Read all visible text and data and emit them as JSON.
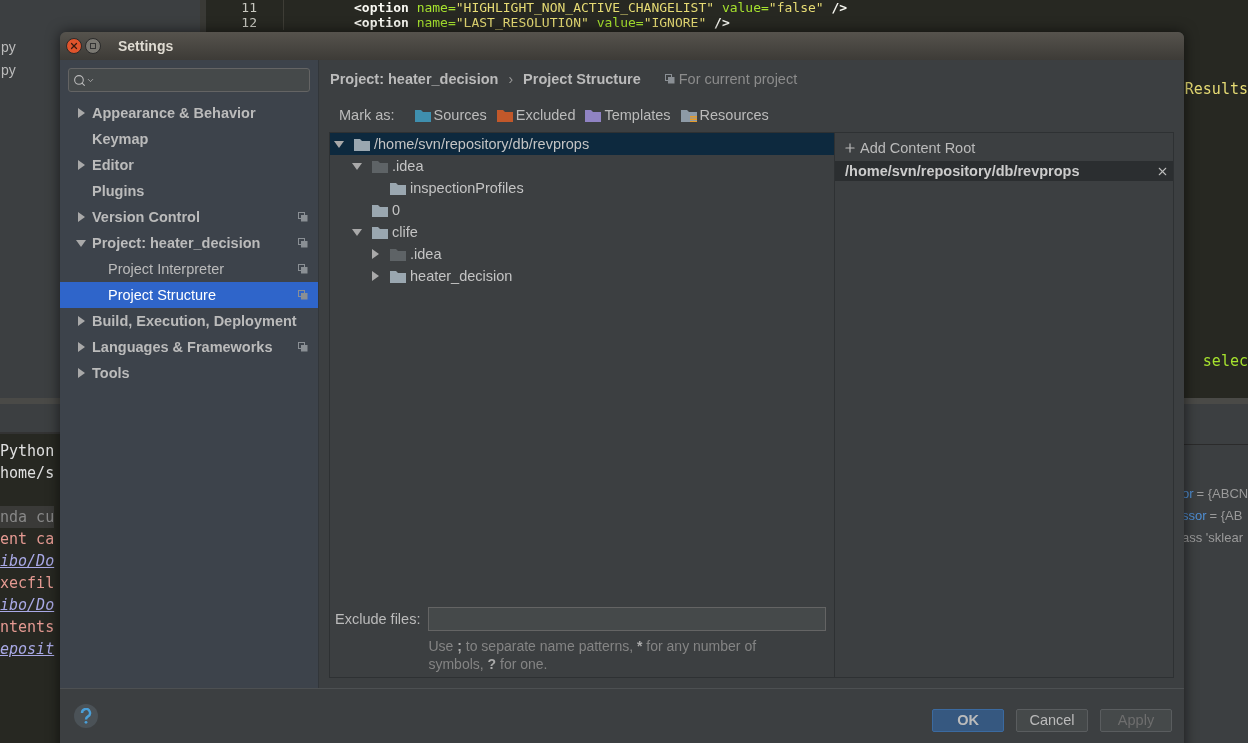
{
  "background": {
    "project_pane": {
      "items": [
        "py",
        "py"
      ]
    },
    "editor": {
      "lines": [
        {
          "number": "11",
          "segments": [
            {
              "kind": "tag",
              "text": "<option "
            },
            {
              "kind": "attr",
              "text": "name="
            },
            {
              "kind": "value",
              "text": "\"HIGHLIGHT_NON_ACTIVE_CHANGELIST\" "
            },
            {
              "kind": "attr",
              "text": "value="
            },
            {
              "kind": "value",
              "text": "\"false\" "
            },
            {
              "kind": "tag",
              "text": "/>"
            }
          ]
        },
        {
          "number": "12",
          "segments": [
            {
              "kind": "tag",
              "text": "<option "
            },
            {
              "kind": "attr",
              "text": "name="
            },
            {
              "kind": "value",
              "text": "\"LAST_RESOLUTION\" "
            },
            {
              "kind": "attr",
              "text": "value="
            },
            {
              "kind": "value",
              "text": "\"IGNORE\" "
            },
            {
              "kind": "tag",
              "text": "/>"
            }
          ]
        }
      ],
      "fragments": [
        "Results",
        "selec"
      ]
    },
    "console": {
      "lines": [
        {
          "kind": "plain",
          "text": "Python"
        },
        {
          "kind": "plain",
          "text": "home/s"
        },
        {
          "kind": "spacer"
        },
        {
          "kind": "comment",
          "text": "nda cu"
        },
        {
          "kind": "error",
          "text": "ent ca"
        },
        {
          "kind": "link",
          "text": "ibo/Do"
        },
        {
          "kind": "error",
          "text": "xecfil"
        },
        {
          "kind": "link",
          "text": "ibo/Do"
        },
        {
          "kind": "error",
          "text": "ntents"
        },
        {
          "kind": "link",
          "text": "eposit"
        }
      ]
    },
    "variables": {
      "rows": [
        {
          "name": "or",
          "value": "= {ABCN"
        },
        {
          "name": "ssor",
          "value": "= {AB"
        },
        {
          "name": "",
          "value": "ass 'sklear"
        }
      ]
    }
  },
  "window": {
    "title": "Settings"
  },
  "sidebar": {
    "items": [
      {
        "label": "Appearance & Behavior",
        "expanded": false,
        "project_level": false,
        "selected": false
      },
      {
        "label": "Keymap",
        "project_level": false,
        "selected": false
      },
      {
        "label": "Editor",
        "expanded": false,
        "project_level": false,
        "selected": false
      },
      {
        "label": "Plugins",
        "project_level": false,
        "selected": false
      },
      {
        "label": "Version Control",
        "expanded": false,
        "project_level": true,
        "selected": false
      },
      {
        "label": "Project: heater_decision",
        "expanded": true,
        "project_level": true,
        "selected": false,
        "children": [
          {
            "label": "Project Interpreter",
            "project_level": true,
            "selected": false
          },
          {
            "label": "Project Structure",
            "project_level": true,
            "selected": true
          }
        ]
      },
      {
        "label": "Build, Execution, Deployment",
        "expanded": false,
        "project_level": false,
        "selected": false
      },
      {
        "label": "Languages & Frameworks",
        "expanded": false,
        "project_level": true,
        "selected": false
      },
      {
        "label": "Tools",
        "expanded": false,
        "project_level": false,
        "selected": false
      }
    ]
  },
  "breadcrumb": {
    "items": [
      "Project: heater_decision",
      "Project Structure"
    ],
    "separator": "›",
    "scope": "For current project"
  },
  "mark_as": {
    "label": "Mark as:",
    "options": [
      {
        "label": "Sources",
        "kind": "plain",
        "color": "#3f8fae"
      },
      {
        "label": "Excluded",
        "kind": "plain",
        "color": "#c2582a"
      },
      {
        "label": "Templates",
        "kind": "plain",
        "color": "#9083c3"
      },
      {
        "label": "Resources",
        "kind": "striped",
        "color": "#8d9aa6"
      }
    ]
  },
  "tree": [
    {
      "label": "/home/svn/repository/db/revprops",
      "expanded": true,
      "selected": true,
      "dim": false,
      "children": [
        {
          "label": ".idea",
          "expanded": true,
          "selected": false,
          "dim": true,
          "children": [
            {
              "label": "inspectionProfiles",
              "selected": false,
              "dim": false
            }
          ]
        },
        {
          "label": "0",
          "selected": false,
          "dim": false
        },
        {
          "label": "clife",
          "expanded": true,
          "selected": false,
          "dim": false,
          "children": [
            {
              "label": ".idea",
              "expanded": false,
              "selected": false,
              "dim": true
            },
            {
              "label": "heater_decision",
              "expanded": false,
              "selected": false,
              "dim": false
            }
          ]
        }
      ]
    }
  ],
  "content_roots": {
    "add_label": "Add Content Root",
    "roots": [
      "/home/svn/repository/db/revprops"
    ]
  },
  "exclude_files": {
    "label": "Exclude files:",
    "hint": "Use **;** to separate name patterns, ***** for any number of symbols, **?** for one."
  },
  "footer": {
    "buttons": [
      {
        "label": "OK",
        "kind": "default",
        "disabled": false
      },
      {
        "label": "Cancel",
        "kind": "normal",
        "disabled": false
      },
      {
        "label": "Apply",
        "kind": "normal",
        "disabled": true
      }
    ]
  }
}
